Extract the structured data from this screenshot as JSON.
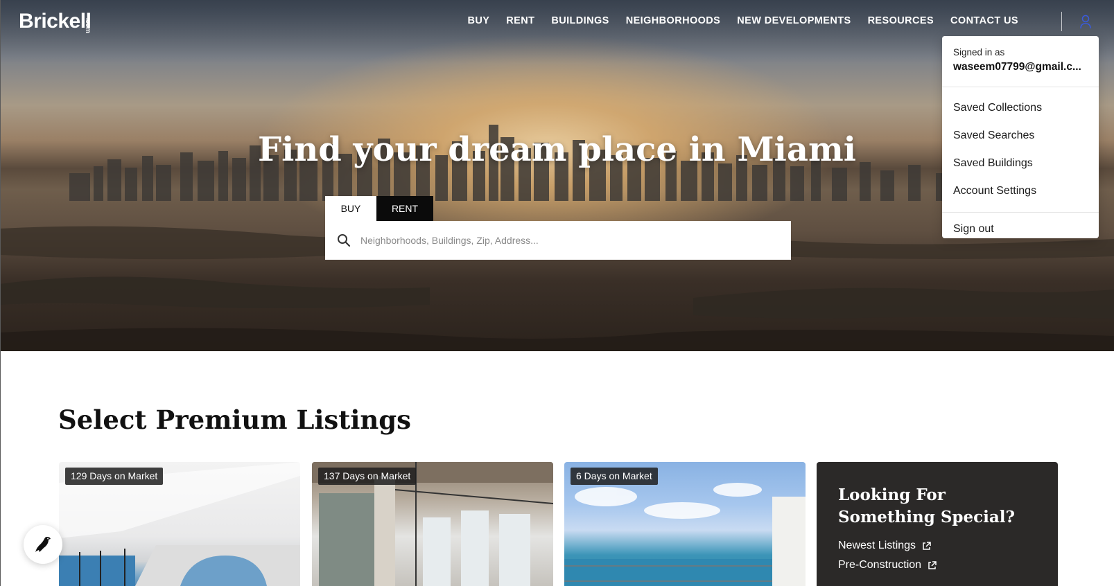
{
  "header": {
    "logo_text": "Brickell",
    "logo_suffix": ".com",
    "nav": [
      "BUY",
      "RENT",
      "BUILDINGS",
      "NEIGHBORHOODS",
      "NEW DEVELOPMENTS",
      "RESOURCES",
      "CONTACT US"
    ],
    "user_icon": "user-icon"
  },
  "hero": {
    "title": "Find your dream place in Miami",
    "tabs": {
      "buy": "BUY",
      "rent": "RENT",
      "selected": "BUY"
    },
    "search": {
      "placeholder": "Neighborhoods, Buildings, Zip, Address...",
      "value": "",
      "icon": "search-icon"
    }
  },
  "account_menu": {
    "signed_in_label": "Signed in as",
    "email": "waseem07799@gmail.c...",
    "items": [
      "Saved Collections",
      "Saved Searches",
      "Saved Buildings",
      "Account Settings"
    ],
    "sign_out": "Sign out"
  },
  "listings": {
    "title": "Select Premium Listings",
    "cards": [
      {
        "days": "129 Days on Market"
      },
      {
        "days": "137 Days on Market"
      },
      {
        "days": "6 Days on Market"
      }
    ],
    "promo": {
      "title": "Looking For Something Special?",
      "links": [
        "Newest Listings",
        "Pre-Construction"
      ]
    }
  },
  "colors": {
    "accent": "#3b5bdb",
    "dark": "#2b2928",
    "badge": "#1e1e1e"
  }
}
